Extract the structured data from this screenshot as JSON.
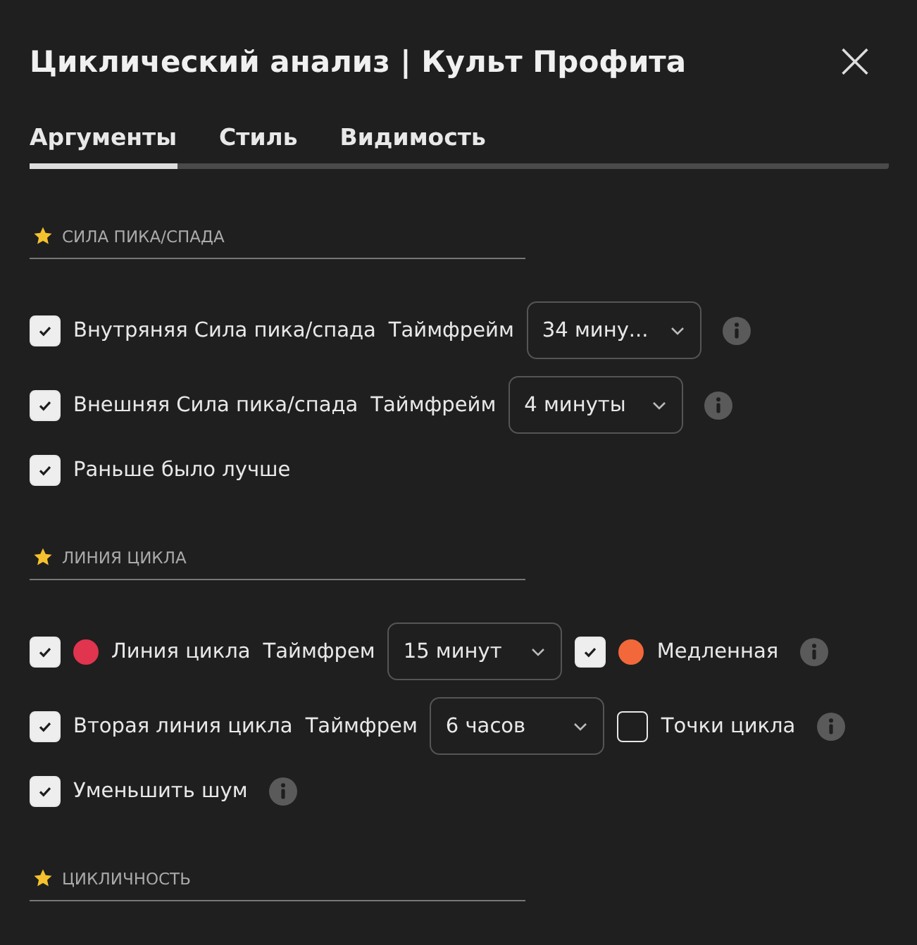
{
  "window": {
    "title": "Циклический анализ | Культ Профита",
    "close": "×"
  },
  "tabs": [
    {
      "label": "Аргументы",
      "selected": true
    },
    {
      "label": "Стиль",
      "selected": false
    },
    {
      "label": "Видимость",
      "selected": false
    }
  ],
  "sections": [
    {
      "title": "СИЛА ПИКА/СПАДА",
      "rows": [
        {
          "items": [
            {
              "kind": "checkbox",
              "checked": true
            },
            {
              "kind": "label",
              "text": "Внутряняя Сила пика/спада"
            },
            {
              "kind": "label",
              "text": "Таймфрейм"
            },
            {
              "kind": "select",
              "value": "34 мину..."
            },
            {
              "kind": "info"
            }
          ]
        },
        {
          "items": [
            {
              "kind": "checkbox",
              "checked": true
            },
            {
              "kind": "label",
              "text": "Внешняя Сила пика/спада"
            },
            {
              "kind": "label",
              "text": "Таймфрейм"
            },
            {
              "kind": "select",
              "value": "4 минуты"
            },
            {
              "kind": "info"
            }
          ]
        },
        {
          "items": [
            {
              "kind": "checkbox",
              "checked": true
            },
            {
              "kind": "label",
              "text": "Раньше было лучше"
            }
          ]
        }
      ]
    },
    {
      "title": "ЛИНИЯ ЦИКЛА",
      "rows": [
        {
          "items": [
            {
              "kind": "checkbox",
              "checked": true
            },
            {
              "kind": "dot",
              "color": "#e0344f"
            },
            {
              "kind": "label",
              "text": "Линия цикла"
            },
            {
              "kind": "label",
              "text": "Таймфрем"
            },
            {
              "kind": "select",
              "value": "15 минут"
            },
            {
              "kind": "checkbox",
              "checked": true
            },
            {
              "kind": "dot",
              "color": "#f2683a"
            },
            {
              "kind": "label",
              "text": "Медленная"
            },
            {
              "kind": "info"
            }
          ]
        },
        {
          "items": [
            {
              "kind": "checkbox",
              "checked": true
            },
            {
              "kind": "label",
              "text": "Вторая линия цикла"
            },
            {
              "kind": "label",
              "text": "Таймфрем"
            },
            {
              "kind": "select",
              "value": "6 часов"
            },
            {
              "kind": "checkbox",
              "checked": false
            },
            {
              "kind": "label",
              "text": "Точки цикла"
            },
            {
              "kind": "info"
            }
          ]
        },
        {
          "items": [
            {
              "kind": "checkbox",
              "checked": true
            },
            {
              "kind": "label",
              "text": "Уменьшить шум"
            },
            {
              "kind": "info"
            }
          ]
        }
      ]
    },
    {
      "title": "ЦИКЛИЧНОСТЬ"
    }
  ]
}
